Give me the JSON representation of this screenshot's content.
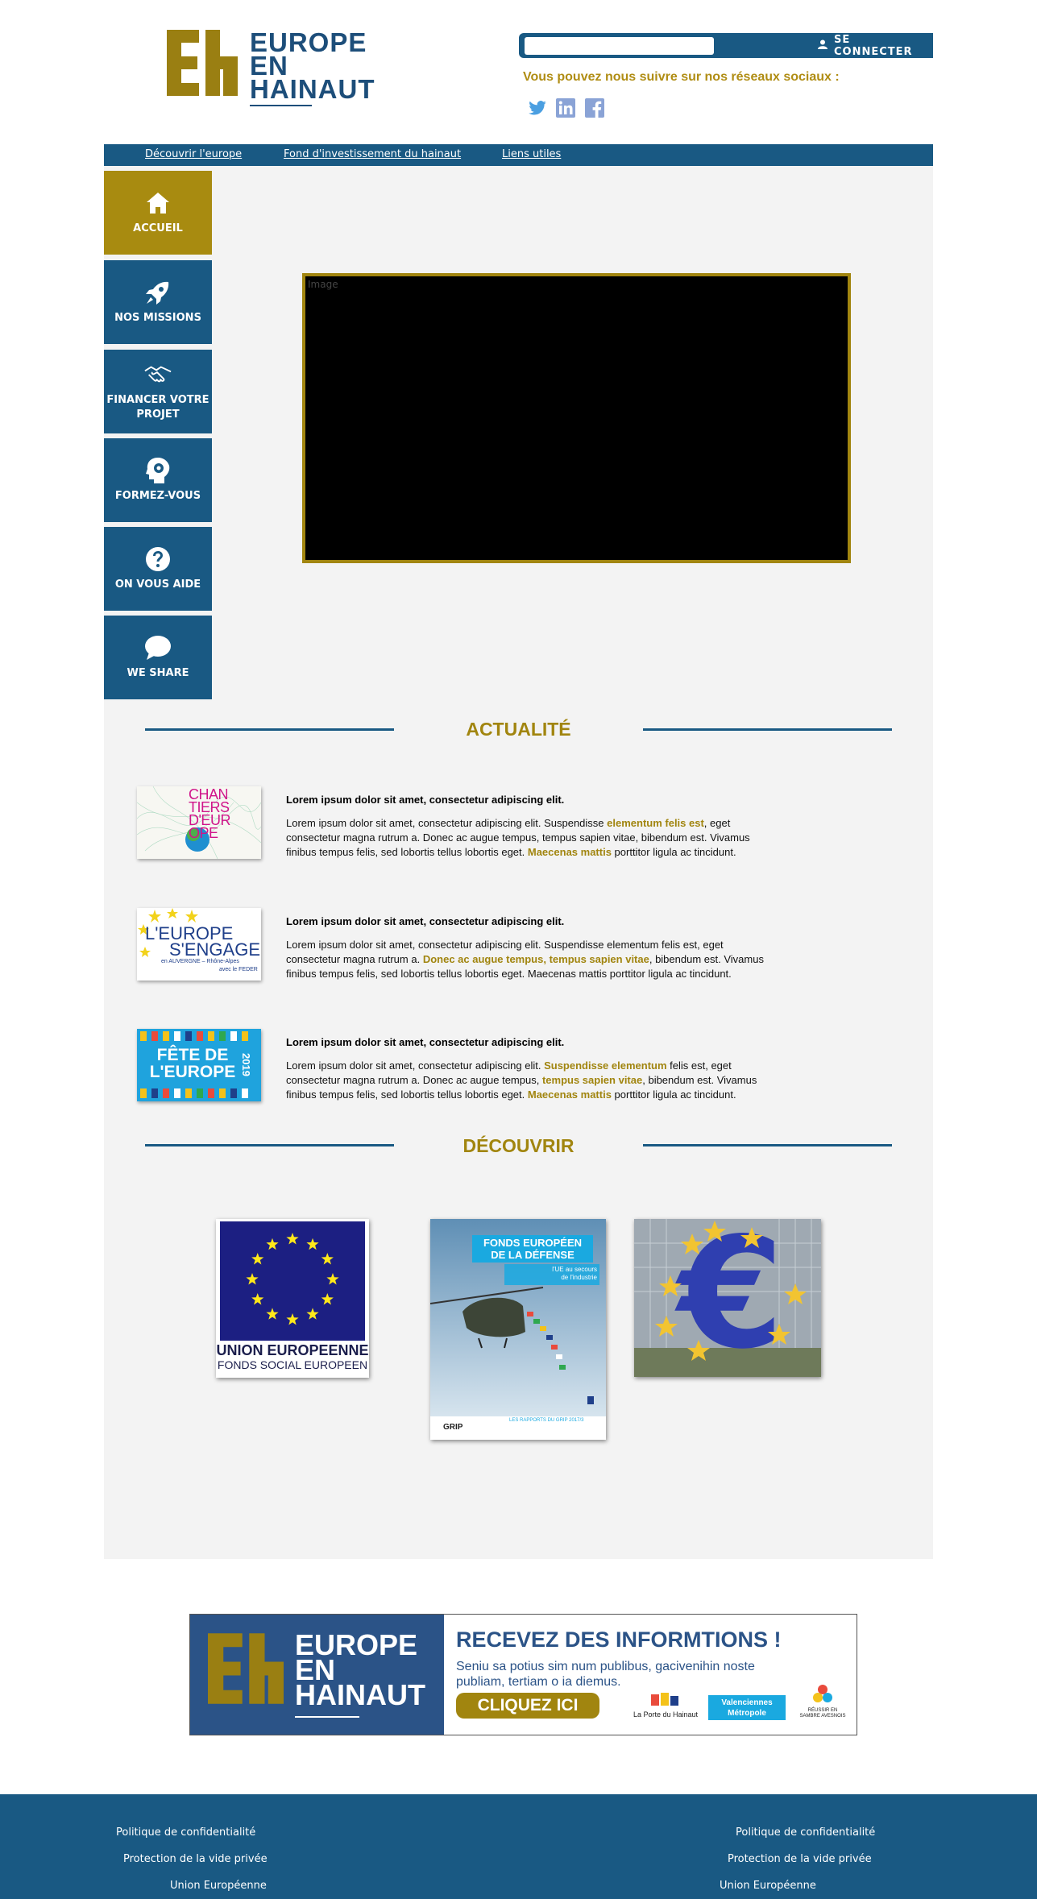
{
  "brand": {
    "logo_lines": [
      "EUROPE",
      "EN",
      "HAINAUT"
    ],
    "colors": {
      "primary_blue": "#195983",
      "gold": "#a1850f",
      "panel_bg": "#f3f3f3",
      "active_bg": "#a88b10"
    }
  },
  "header": {
    "login_label": "SE CONNECTER",
    "login_icon": "user-icon",
    "search_value": "",
    "follow_text": "Vous pouvez nous suivre sur nos réseaux sociaux :",
    "social": [
      "twitter-icon",
      "linkedin-icon",
      "facebook-icon"
    ]
  },
  "nav": {
    "items": [
      "Découvrir l'europe",
      "Fond d'investissement du hainaut",
      "Liens utiles"
    ]
  },
  "sidebar": {
    "items": [
      {
        "label": "ACCUEIL",
        "icon": "home-icon",
        "active": true
      },
      {
        "label": "NOS MISSIONS",
        "icon": "rocket-icon",
        "active": false
      },
      {
        "label": "FINANCER VOTRE PROJET",
        "icon": "handshake-icon",
        "active": false
      },
      {
        "label": "FORMEZ-VOUS",
        "icon": "head-gear-icon",
        "active": false
      },
      {
        "label": "ON VOUS AIDE",
        "icon": "question-icon",
        "active": false
      },
      {
        "label": "WE SHARE",
        "icon": "chat-bubble-icon",
        "active": false
      }
    ]
  },
  "video": {
    "placeholder": "Image"
  },
  "actualite": {
    "title": "ACTUALITÉ",
    "items": [
      {
        "image_text": [
          "CHAN",
          "TIERS",
          "D'EUR",
          "OPE"
        ],
        "title": "Lorem ipsum dolor sit amet, consectetur adipiscing elit.",
        "body": [
          {
            "t": "Lorem ipsum dolor sit amet, consectetur adipiscing elit. Suspendisse ",
            "h": false
          },
          {
            "t": "elementum felis est",
            "h": true
          },
          {
            "t": ", eget consectetur magna rutrum a. Donec ac augue tempus, tempus sapien vitae, bibendum est. Vivamus finibus tempus felis, sed lobortis tellus lobortis eget. ",
            "h": false
          },
          {
            "t": "Maecenas mattis",
            "h": true
          },
          {
            "t": " porttitor ligula ac tincidunt.",
            "h": false
          }
        ]
      },
      {
        "image_text": [
          "L'EUROPE",
          "S'ENGAGE",
          "en AUVERGNE – Rhône-Alpes",
          "avec le FEDER"
        ],
        "title": "Lorem ipsum dolor sit amet, consectetur adipiscing elit.",
        "body": [
          {
            "t": "Lorem ipsum dolor sit amet, consectetur adipiscing elit. Suspendisse elementum felis est, eget consectetur magna rutrum a. ",
            "h": false
          },
          {
            "t": "Donec ac augue tempus, tempus sapien vitae",
            "h": true
          },
          {
            "t": ", bibendum est. Vivamus finibus tempus felis, sed lobortis tellus lobortis eget. Maecenas mattis porttitor ligula ac tincidunt.",
            "h": false
          }
        ]
      },
      {
        "image_text": [
          "FÊTE DE",
          "L'EUROPE",
          "2019"
        ],
        "title": "Lorem ipsum dolor sit amet, consectetur adipiscing elit.",
        "body": [
          {
            "t": "Lorem ipsum dolor sit amet, consectetur adipiscing elit. ",
            "h": false
          },
          {
            "t": "Suspendisse elementum",
            "h": true
          },
          {
            "t": " felis est, eget consectetur magna rutrum a. Donec ac augue tempus, ",
            "h": false
          },
          {
            "t": "tempus sapien vitae",
            "h": true
          },
          {
            "t": ", bibendum est. Vivamus finibus tempus felis, sed lobortis tellus lobortis eget. ",
            "h": false
          },
          {
            "t": "Maecenas mattis",
            "h": true
          },
          {
            "t": " porttitor ligula ac tincidunt.",
            "h": false
          }
        ]
      }
    ]
  },
  "decouvrir": {
    "title": "DÉCOUVRIR",
    "cards": [
      {
        "lines": [
          "UNION EUROPEENNE",
          "FONDS SOCIAL EUROPEEN"
        ]
      },
      {
        "lines": [
          "FONDS EUROPÉEN",
          "DE LA DÉFENSE",
          "l'UE au secours",
          "de l'industrie",
          "LES RAPPORTS DU GRIP 2017/3",
          "GRIP"
        ]
      },
      {
        "lines": [
          "€"
        ]
      }
    ]
  },
  "banner": {
    "logo_lines": [
      "EUROPE",
      "EN",
      "HAINAUT"
    ],
    "title": "RECEVEZ DES INFORMTIONS !",
    "subtitle": "Seniu sa potius sim num publibus, gacivenihin noste publiam, tertiam o ia diemus.",
    "cta": "CLIQUEZ ICI",
    "partners": [
      "La Porte du Hainaut",
      "Valenciennes Métropole",
      "RÉUSSIR EN SAMBRE AVESNOIS"
    ]
  },
  "footer": {
    "left": [
      "Politique de confidentialité",
      "Protection de la vide privée",
      "Union Européenne"
    ],
    "right": [
      "Politique de confidentialité",
      "Protection de la vide privée",
      "Union Européenne"
    ]
  }
}
